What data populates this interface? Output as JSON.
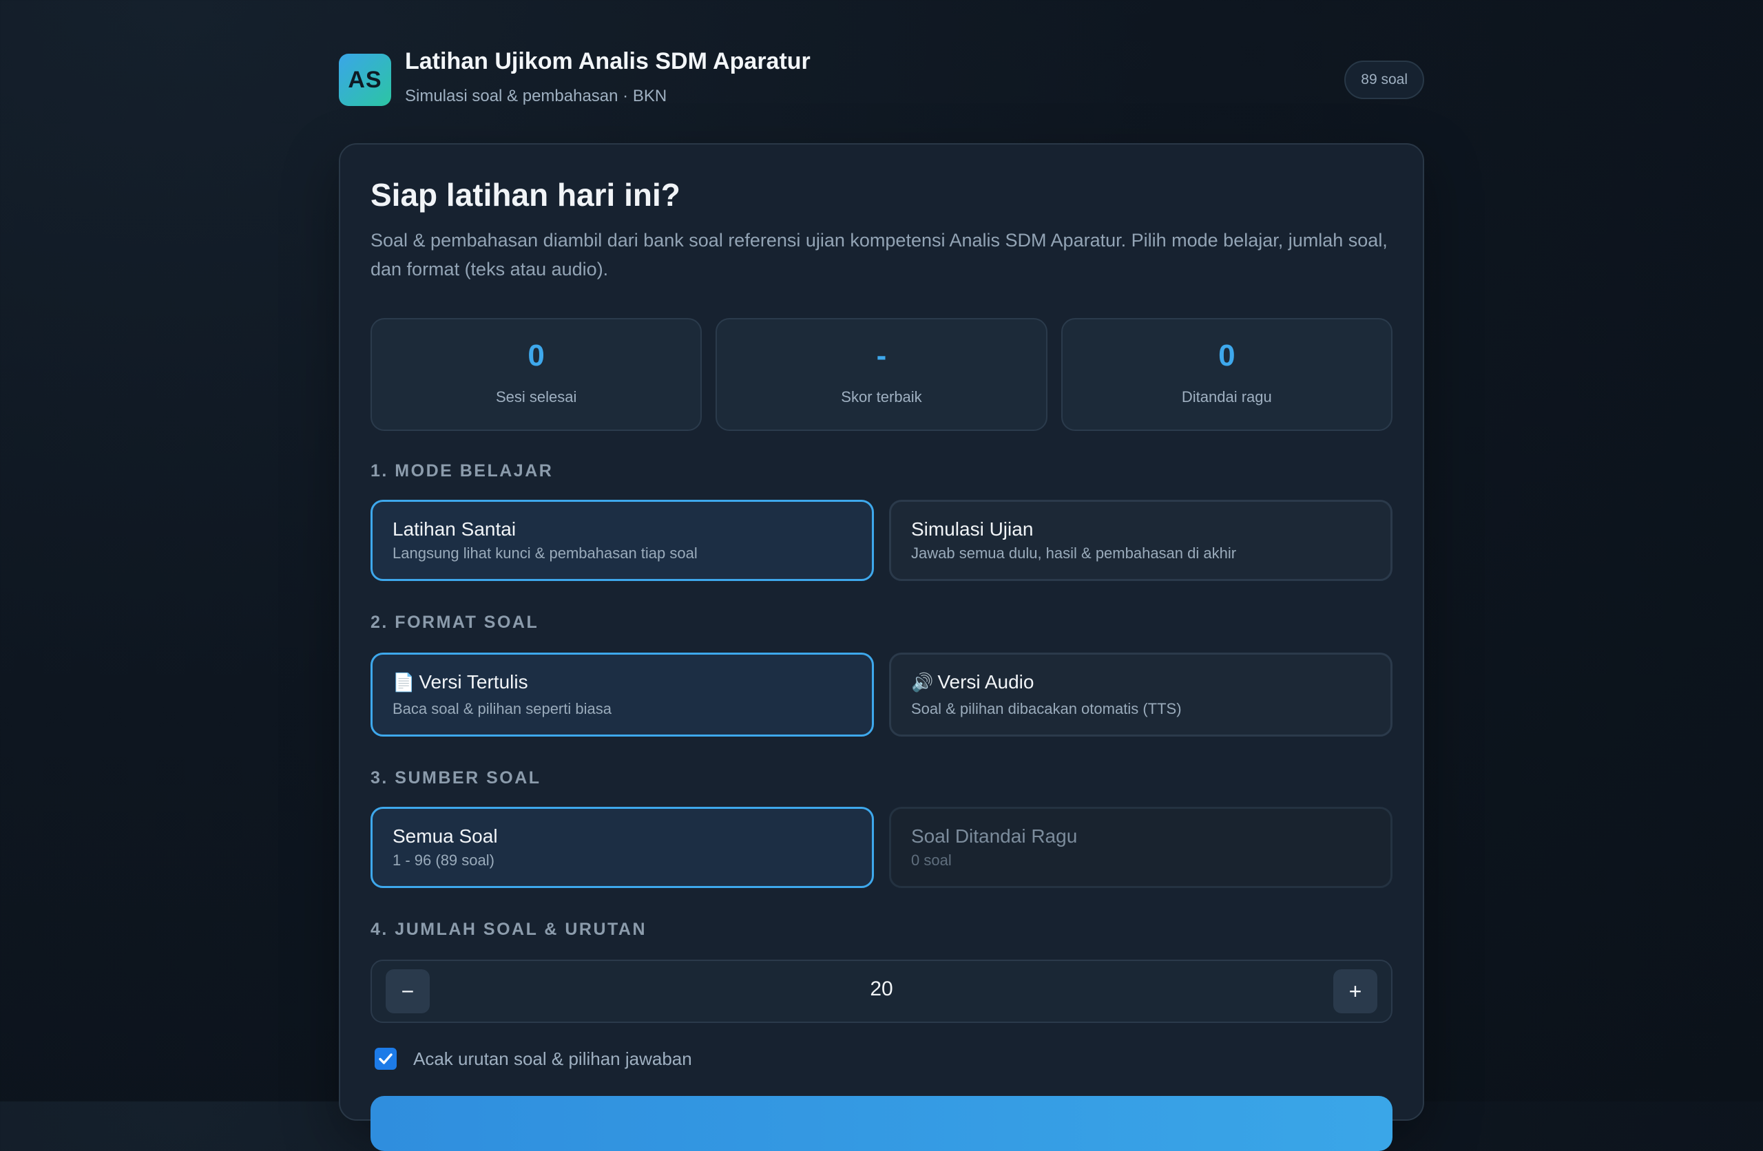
{
  "header": {
    "logo_text": "AS",
    "title": "Latihan Ujikom Analis SDM Aparatur",
    "subtitle": "Simulasi soal & pembahasan · BKN",
    "count_badge": "89 soal"
  },
  "hero": {
    "title": "Siap latihan hari ini?",
    "description": "Soal & pembahasan diambil dari bank soal referensi ujian kompetensi Analis SDM Aparatur. Pilih mode belajar, jumlah soal, dan format (teks atau audio)."
  },
  "stats": [
    {
      "value": "0",
      "label": "Sesi selesai"
    },
    {
      "value": "-",
      "label": "Skor terbaik"
    },
    {
      "value": "0",
      "label": "Ditandai ragu"
    }
  ],
  "sections": {
    "mode": {
      "label": "1. MODE BELAJAR",
      "options": [
        {
          "title": "Latihan Santai",
          "desc": "Langsung lihat kunci & pembahasan tiap soal",
          "selected": true
        },
        {
          "title": "Simulasi Ujian",
          "desc": "Jawab semua dulu, hasil & pembahasan di akhir",
          "selected": false
        }
      ]
    },
    "format": {
      "label": "2. FORMAT SOAL",
      "options": [
        {
          "icon": "📄",
          "title": "Versi Tertulis",
          "desc": "Baca soal & pilihan seperti biasa",
          "selected": true
        },
        {
          "icon": "🔊",
          "title": "Versi Audio",
          "desc": "Soal & pilihan dibacakan otomatis (TTS)",
          "selected": false
        }
      ]
    },
    "source": {
      "label": "3. SUMBER SOAL",
      "options": [
        {
          "title": "Semua Soal",
          "desc": "1 - 96 (89 soal)",
          "selected": true
        },
        {
          "title": "Soal Ditandai Ragu",
          "desc": "0 soal",
          "selected": false,
          "disabled": true
        }
      ]
    },
    "count": {
      "label": "4. JUMLAH SOAL & URUTAN",
      "value": "20",
      "minus": "−",
      "plus": "+",
      "shuffle_label": "Acak urutan soal & pilihan jawaban",
      "shuffle_checked": true
    }
  },
  "colors": {
    "accent": "#3ea8ec",
    "checkbox": "#1d7be8"
  }
}
